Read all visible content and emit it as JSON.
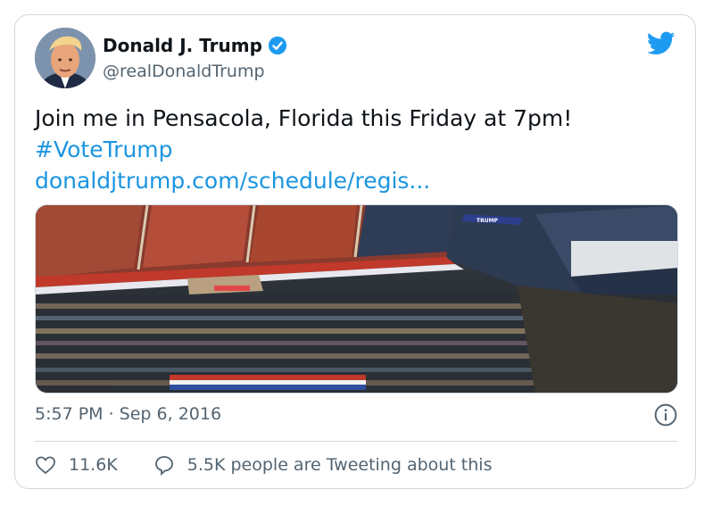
{
  "tweet": {
    "display_name": "Donald J. Trump",
    "handle": "@realDonaldTrump",
    "text_line1": "Join me in Pensacola, Florida this Friday at 7pm!",
    "hashtag": "#VoteTrump",
    "link": "donaldjtrump.com/schedule/regis...",
    "timestamp": "5:57 PM · Sep 6, 2016",
    "likes": "11.6K",
    "conversation": "5.5K people are Tweeting about this",
    "banner_text": "TRUMP"
  },
  "icons": {
    "verified": "verified-badge-icon",
    "brand": "twitter-bird-icon",
    "info": "info-icon",
    "like": "heart-icon",
    "reply": "speech-bubble-icon"
  },
  "colors": {
    "link": "#1b95e0",
    "verified": "#1d9bf0",
    "muted": "#536471",
    "border": "#cfd9de"
  }
}
